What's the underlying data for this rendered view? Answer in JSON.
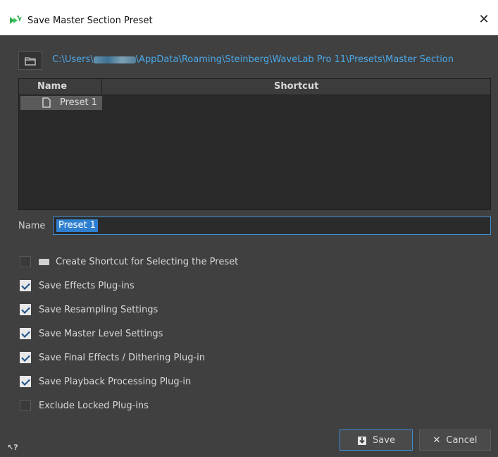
{
  "window": {
    "title": "Save Master Section Preset",
    "close_glyph": "✕"
  },
  "path": {
    "prefix": "C:\\Users\\",
    "suffix": "\\AppData\\Roaming\\Steinberg\\WaveLab Pro 11\\Presets\\Master Section"
  },
  "table": {
    "columns": [
      "Name",
      "Shortcut"
    ],
    "rows": [
      {
        "name": "Preset 1",
        "shortcut": ""
      }
    ]
  },
  "name_field": {
    "label": "Name",
    "value": "Preset 1"
  },
  "options": [
    {
      "label": "Create Shortcut for Selecting the Preset",
      "checked": false,
      "icon": "keyboard-icon"
    },
    {
      "label": "Save Effects Plug-ins",
      "checked": true
    },
    {
      "label": "Save Resampling Settings",
      "checked": true
    },
    {
      "label": "Save Master Level Settings",
      "checked": true
    },
    {
      "label": "Save Final Effects / Dithering Plug-in",
      "checked": true
    },
    {
      "label": "Save Playback Processing Plug-in",
      "checked": true
    },
    {
      "label": "Exclude Locked Plug-ins",
      "checked": false
    }
  ],
  "buttons": {
    "save": "Save",
    "cancel": "Cancel",
    "cancel_glyph": "✕"
  },
  "help_glyph": "↖?",
  "colors": {
    "accent": "#3d8fd6",
    "path": "#4aa8e8",
    "background": "#404040"
  }
}
